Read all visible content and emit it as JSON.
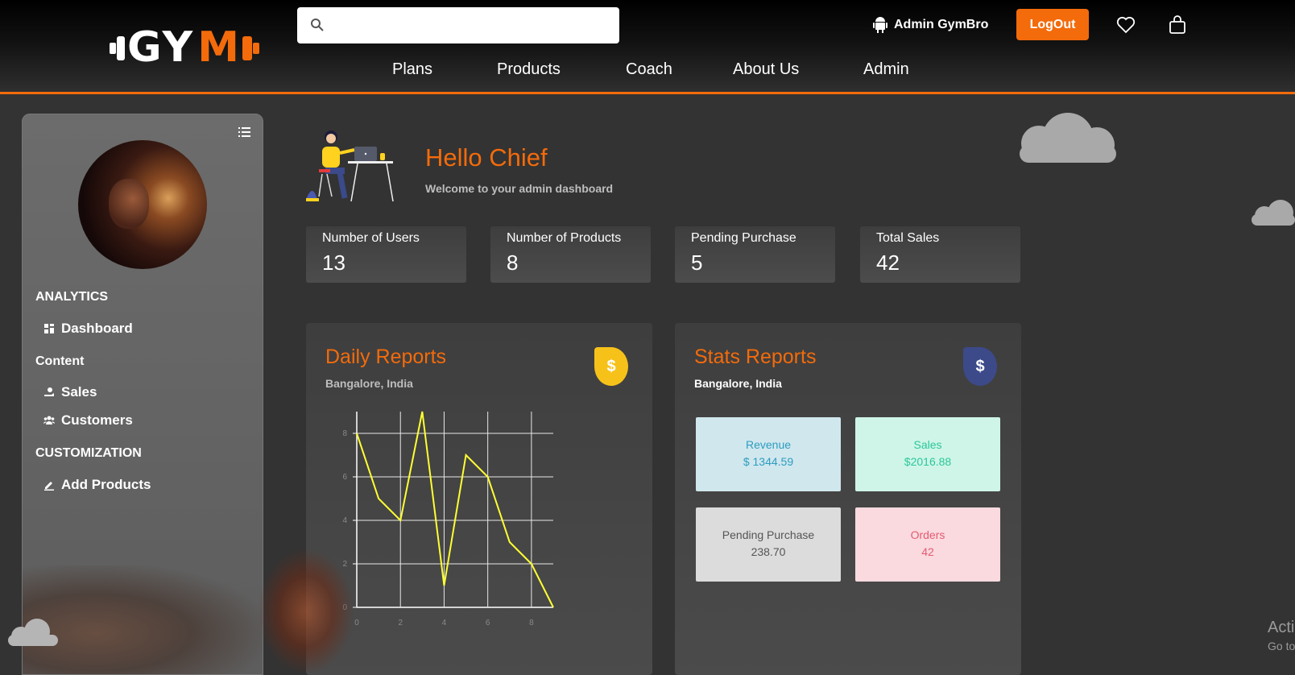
{
  "header": {
    "logo_text_left": "GY",
    "logo_text_right": "M",
    "search_placeholder": "",
    "username": "Admin GymBro",
    "logout_label": "LogOut",
    "nav": [
      "Plans",
      "Products",
      "Coach",
      "About Us",
      "Admin"
    ]
  },
  "sidebar": {
    "sections": [
      {
        "heading": "ANALYTICS",
        "items": [
          "Dashboard"
        ]
      },
      {
        "heading": "Content",
        "items": [
          "Sales",
          "Customers"
        ]
      },
      {
        "heading": "CUSTOMIZATION",
        "items": [
          "Add Products"
        ]
      }
    ]
  },
  "main": {
    "greeting": "Hello Chief",
    "welcome": "Welcome to your admin dashboard",
    "stats": [
      {
        "label": "Number of Users",
        "value": "13"
      },
      {
        "label": "Number of Products",
        "value": "8"
      },
      {
        "label": "Pending Purchase",
        "value": "5"
      },
      {
        "label": "Total Sales",
        "value": "42"
      }
    ],
    "daily": {
      "title": "Daily Reports",
      "location": "Bangalore, India",
      "icon": "$"
    },
    "stats_report": {
      "title": "Stats Reports",
      "location": "Bangalore, India",
      "icon": "$",
      "tiles": [
        {
          "label": "Revenue",
          "value": "$ 1344.59",
          "bg": "#d1e7ee",
          "fg": "#2c9dbf"
        },
        {
          "label": "Sales",
          "value": "$2016.88",
          "bg": "#cff5e8",
          "fg": "#2bc79a"
        },
        {
          "label": "Pending Purchase",
          "value": "238.70",
          "bg": "#dcdcdc",
          "fg": "#555555"
        },
        {
          "label": "Orders",
          "value": "42",
          "bg": "#fadadf",
          "fg": "#e55a72"
        }
      ]
    }
  },
  "watermark": {
    "line1": "Acti",
    "line2": "Go to"
  },
  "colors": {
    "accent": "#f36b0b",
    "line": "#ffff33",
    "dollar_yellow": "#f6c21a",
    "dollar_navy": "#3c4a8a"
  },
  "chart_data": {
    "type": "line",
    "x": [
      0,
      1,
      2,
      3,
      4,
      5,
      6,
      7,
      8,
      9
    ],
    "series": [
      {
        "values": [
          8,
          5,
          4,
          9,
          1,
          7,
          6,
          3,
          2,
          0
        ]
      }
    ],
    "xticks": [
      "0",
      "2",
      "4",
      "6",
      "8"
    ],
    "yticks": [
      "0",
      "2",
      "4",
      "6",
      "8"
    ],
    "xlim": [
      0,
      9
    ],
    "ylim": [
      0,
      9
    ],
    "grid": true,
    "title": "",
    "xlabel": "",
    "ylabel": ""
  }
}
